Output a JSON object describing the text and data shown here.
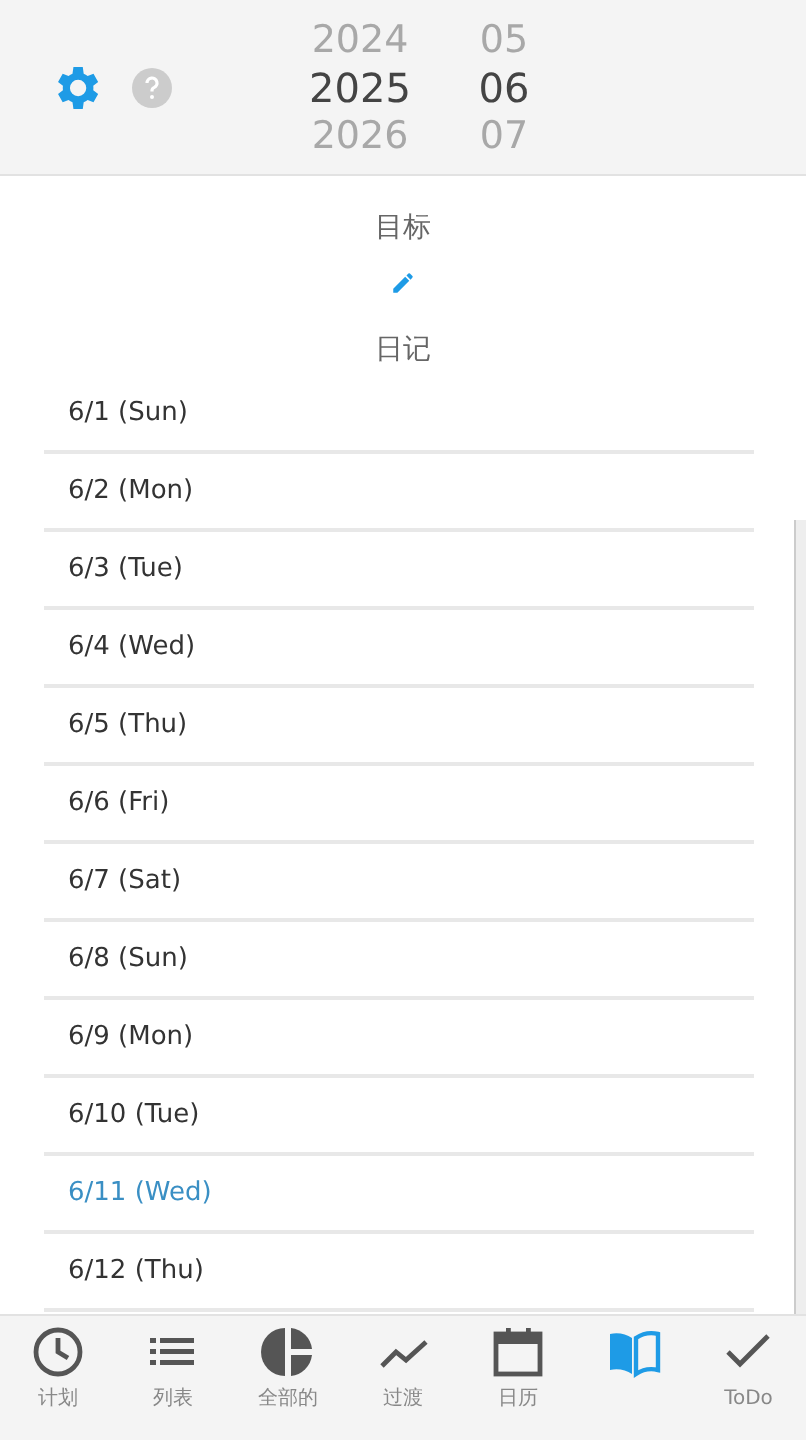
{
  "header": {
    "years": [
      {
        "label": "2024",
        "selected": false
      },
      {
        "label": "2025",
        "selected": true
      },
      {
        "label": "2026",
        "selected": false
      }
    ],
    "months": [
      {
        "label": "05",
        "selected": false
      },
      {
        "label": "06",
        "selected": true
      },
      {
        "label": "07",
        "selected": false
      }
    ]
  },
  "goal": {
    "title": "目标"
  },
  "diary": {
    "title": "日记",
    "days": [
      {
        "label": "6/1 (Sun)",
        "today": false
      },
      {
        "label": "6/2 (Mon)",
        "today": false
      },
      {
        "label": "6/3 (Tue)",
        "today": false
      },
      {
        "label": "6/4 (Wed)",
        "today": false
      },
      {
        "label": "6/5 (Thu)",
        "today": false
      },
      {
        "label": "6/6 (Fri)",
        "today": false
      },
      {
        "label": "6/7 (Sat)",
        "today": false
      },
      {
        "label": "6/8 (Sun)",
        "today": false
      },
      {
        "label": "6/9 (Mon)",
        "today": false
      },
      {
        "label": "6/10 (Tue)",
        "today": false
      },
      {
        "label": "6/11 (Wed)",
        "today": true
      },
      {
        "label": "6/12 (Thu)",
        "today": false
      }
    ]
  },
  "tabs": [
    {
      "kind": "clock",
      "label": "计划",
      "selected": false
    },
    {
      "kind": "list",
      "label": "列表",
      "selected": false
    },
    {
      "kind": "pie",
      "label": "全部的",
      "selected": false
    },
    {
      "kind": "trend",
      "label": "过渡",
      "selected": false
    },
    {
      "kind": "calendar",
      "label": "日历",
      "selected": false
    },
    {
      "kind": "book",
      "selected": true
    },
    {
      "kind": "check",
      "label": "ToDo",
      "selected": false
    }
  ]
}
